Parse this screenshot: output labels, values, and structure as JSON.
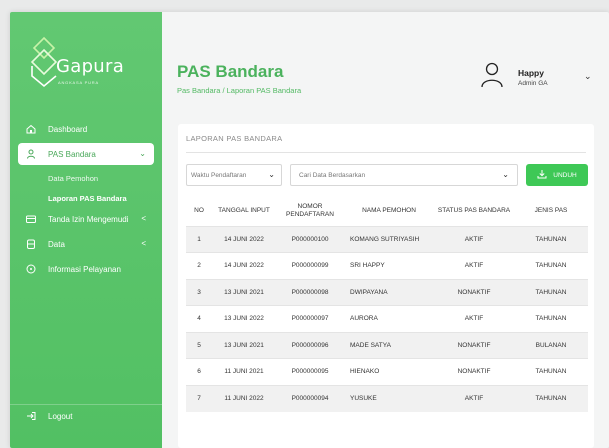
{
  "brand": {
    "name": "Gapura",
    "tagline": "ANGKASA PURA"
  },
  "sidebar": {
    "items": [
      {
        "label": "Dashboard",
        "icon": "home-icon"
      },
      {
        "label": "PAS Bandara",
        "icon": "person-icon"
      },
      {
        "label": "Tanda Izin Mengemudi",
        "icon": "card-icon"
      },
      {
        "label": "Data",
        "icon": "database-icon"
      },
      {
        "label": "Informasi Pelayanan",
        "icon": "info-icon"
      }
    ],
    "sub_items": [
      "Data Pemohon",
      "Laporan PAS Bandara"
    ],
    "logout": "Logout"
  },
  "header": {
    "title": "PAS Bandara",
    "breadcrumb": "Pas Bandara / Laporan PAS Bandara"
  },
  "user": {
    "name": "Happy",
    "role": "Admin GA"
  },
  "report": {
    "title": "LAPORAN PAS BANDARA",
    "date_filter": "Waktu Pendaftaran",
    "search_placeholder": "Cari Data Berdasarkan",
    "download_label": "UNDUH",
    "columns": [
      "NO",
      "TANGGAL INPUT",
      "NOMOR PENDAFTARAN",
      "NAMA PEMOHON",
      "STATUS PAS BANDARA",
      "JENIS PAS"
    ],
    "rows": [
      [
        "1",
        "14 JUNI 2022",
        "P000000100",
        "KOMANG SUTRIYASIH",
        "AKTIF",
        "TAHUNAN"
      ],
      [
        "2",
        "14 JUNI 2022",
        "P000000099",
        "SRI HAPPY",
        "AKTIF",
        "TAHUNAN"
      ],
      [
        "3",
        "13 JUNI 2021",
        "P000000098",
        "DWIPAYANA",
        "NONAKTIF",
        "TAHUNAN"
      ],
      [
        "4",
        "13 JUNI 2022",
        "P000000097",
        "AURORA",
        "AKTIF",
        "TAHUNAN"
      ],
      [
        "5",
        "13 JUNI 2021",
        "P000000096",
        "MADE SATYA",
        "NONAKTIF",
        "BULANAN"
      ],
      [
        "6",
        "11 JUNI 2021",
        "P000000095",
        "HIENAKO",
        "NONAKTIF",
        "TAHUNAN"
      ],
      [
        "7",
        "11 JUNI 2022",
        "P000000094",
        "YUSUKE",
        "AKTIF",
        "TAHUNAN"
      ]
    ]
  },
  "colors": {
    "primary": "#52c063",
    "accent": "#3ec856",
    "title": "#4bb25d"
  }
}
